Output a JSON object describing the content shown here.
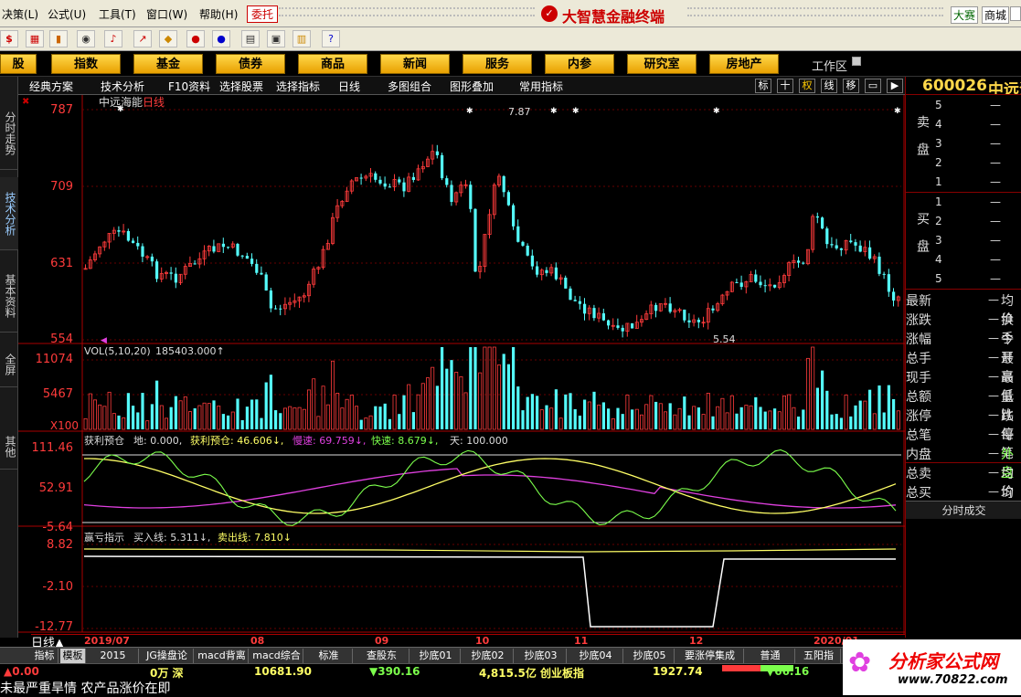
{
  "menu": {
    "items": [
      "决策(L)",
      "公式(U)",
      "工具(T)",
      "窗口(W)",
      "帮助(H)"
    ],
    "tag": "委托",
    "title": "大智慧金融终端",
    "right": [
      "大赛",
      "商城"
    ]
  },
  "nav": {
    "items": [
      "股",
      "指数",
      "基金",
      "债券",
      "商品",
      "新闻",
      "服务",
      "内参",
      "研究室",
      "房地产"
    ],
    "workspace": "工作区"
  },
  "side_tabs": [
    "分时走势",
    "技术分析",
    "基本资料",
    "全屏",
    "其他"
  ],
  "chart_tools": {
    "items": [
      "经典方案",
      "技术分析",
      "F10资料",
      "选择股票",
      "选择指标",
      "日线",
      "多图组合",
      "图形叠加",
      "常用指标"
    ],
    "icons": [
      "标",
      "十",
      "权",
      "线",
      "移"
    ]
  },
  "stock": {
    "code": "600026",
    "name": "中远海能",
    "period": "日线"
  },
  "price_axis": [
    "787",
    "709",
    "631",
    "554"
  ],
  "price_notes": {
    "high": "7.87",
    "low": "5.54"
  },
  "vol": {
    "label": "VOL(5,10,20)",
    "value": "185403.000↑",
    "axis": [
      "11074",
      "5467",
      "X100"
    ]
  },
  "ind1": {
    "label": "获利预仓",
    "di": "地: 0.000,",
    "huoli": "获利预仓: 46.606↓,",
    "man": "慢速: 69.759↓,",
    "kuai": "快速: 8.679↓,",
    "tian": "天: 100.000",
    "axis": [
      "111.46",
      "52.91",
      "-5.64"
    ]
  },
  "ind2": {
    "label": "赢亏指示",
    "buy": "买入线: 5.311↓,",
    "sell": "卖出线: 7.810↓",
    "axis": [
      "8.82",
      "-2.10",
      "-12.77"
    ]
  },
  "x_axis": [
    "2019/07",
    "08",
    "09",
    "10",
    "11",
    "12",
    "2020/01"
  ],
  "period_label": "日线▲",
  "quote": {
    "sell": [
      "5",
      "4",
      "3",
      "2",
      "1"
    ],
    "buy": [
      "1",
      "2",
      "3",
      "4",
      "5"
    ],
    "sell_label": "卖盘",
    "buy_label": "买盘",
    "dash": "—",
    "fields": [
      {
        "l": "最新",
        "r": "均价"
      },
      {
        "l": "涨跌",
        "r": "换手"
      },
      {
        "l": "涨幅",
        "r": "今开"
      },
      {
        "l": "总手",
        "r": "最高"
      },
      {
        "l": "现手",
        "r": "最低"
      },
      {
        "l": "总额",
        "r": "量比"
      },
      {
        "l": "涨停",
        "r": "跌停"
      },
      {
        "l": "总笔",
        "r": "每笔"
      },
      {
        "l": "内盘",
        "r": "外盘"
      },
      {
        "l": "总卖",
        "r": "均价"
      },
      {
        "l": "总买",
        "r": "均价"
      }
    ],
    "tick_btn": "分时成交"
  },
  "bottom_tabs": [
    "指标",
    "模板",
    "2015",
    "JG操盘论",
    "macd背离",
    "macd综合",
    "标准",
    "查股东",
    "抄底01",
    "抄底02",
    "抄底03",
    "抄底04",
    "抄底05",
    "要涨停集成",
    "普通",
    "五阳指"
  ],
  "status": {
    "a": "▲0.00",
    "b": "0万 深",
    "c": "10681.90",
    "d": "▼390.16",
    "e": "4,815.5亿 创业板指",
    "f": "1927.74",
    "g": "▼66.16"
  },
  "ticker": "未最严重旱情 农产品涨价在即",
  "logo": {
    "text": "分析家公式网",
    "url": "www.70822.com"
  },
  "colors": {
    "up": "#ff3b3b",
    "down": "#54fcfc",
    "accent": "#ffd84a"
  }
}
